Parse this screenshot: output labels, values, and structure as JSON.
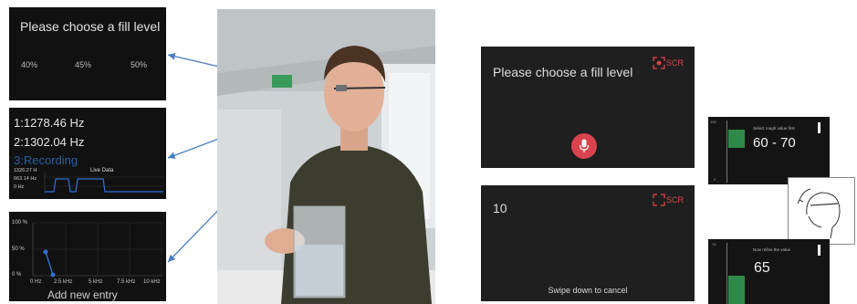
{
  "panel_fill": {
    "title": "Please choose a fill level",
    "options": [
      "40%",
      "45%",
      "50%"
    ]
  },
  "panel_freq": {
    "line1": "1:1278.46 Hz",
    "line2": "2:1302.04 Hz",
    "line3": "3:Recording",
    "mini_label1": "1326.27 H",
    "mini_label2": "663.14 Hz",
    "mini_label3": "0 Hz",
    "mini_title": "Live Data"
  },
  "panel_graph": {
    "y_ticks": [
      "100 %",
      "50 %",
      "0 %"
    ],
    "x_ticks": [
      "0 Hz",
      "2.5 kHz",
      "5 kHz",
      "7.5 kHz",
      "10 kHz"
    ],
    "action": "Add new entry"
  },
  "glass_top": {
    "title": "Please choose a fill level",
    "scr": "SCR"
  },
  "glass_bottom": {
    "value": "10",
    "scr": "SCR",
    "hint": "Swipe down to cancel"
  },
  "mini_top": {
    "caption": "Select rough value first",
    "range": "60 - 70",
    "scale_top": "100",
    "scale_bottom": "0"
  },
  "mini_bottom": {
    "caption": "Now refine the value",
    "value": "65",
    "scale_top": "70"
  },
  "colors": {
    "link_arrow": "#4a7fc1",
    "mic_red": "#d8434e",
    "scr_red": "#e0434b",
    "level_green": "#2f8a49",
    "graph_blue": "#2f6fd0"
  }
}
